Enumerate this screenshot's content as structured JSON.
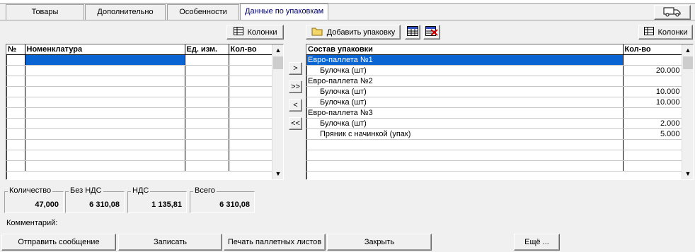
{
  "tabs": [
    {
      "label": "Товары"
    },
    {
      "label": "Дополнительно"
    },
    {
      "label": "Особенности"
    },
    {
      "label": "Данные по упаковкам"
    }
  ],
  "truck_icon": "truck-icon",
  "left": {
    "columns_button": "Колонки",
    "headers": [
      "№",
      "Номенклатура",
      "Ед. изм.",
      "Кол-во"
    ]
  },
  "transfer": {
    "move_right": ">",
    "move_all_right": ">>",
    "move_left": "<",
    "move_all_left": "<<"
  },
  "right": {
    "add_package_button": "Добавить упаковку",
    "columns_button": "Колонки",
    "headers": [
      "Состав упаковки",
      "Кол-во"
    ],
    "rows": [
      {
        "name": "Евро-паллета №1",
        "qty": "",
        "group": true
      },
      {
        "name": "Булочка (шт)",
        "qty": "20.000",
        "group": false
      },
      {
        "name": "Евро-паллета №2",
        "qty": "",
        "group": true
      },
      {
        "name": "Булочка (шт)",
        "qty": "10.000",
        "group": false
      },
      {
        "name": "Булочка (шт)",
        "qty": "10.000",
        "group": false
      },
      {
        "name": "Евро-паллета №3",
        "qty": "",
        "group": true
      },
      {
        "name": "Булочка (шт)",
        "qty": "2.000",
        "group": false
      },
      {
        "name": "Пряник с начинкой (упак)",
        "qty": "5.000",
        "group": false
      }
    ]
  },
  "totals": {
    "quantity_label": "Количество",
    "quantity": "47,000",
    "no_vat_label": "Без НДС",
    "no_vat": "6 310,08",
    "vat_label": "НДС",
    "vat": "1 135,81",
    "total_label": "Всего",
    "total": "6 310,08"
  },
  "comment_label": "Комментарий:",
  "buttons": {
    "send": "Отправить сообщение",
    "save": "Записать",
    "print": "Печать паллетных листов",
    "close": "Закрыть",
    "more": "Ещё ..."
  },
  "colors": {
    "selection": "#0a64d2",
    "background": "#f0f0f0",
    "active_tab_text": "#000066"
  }
}
